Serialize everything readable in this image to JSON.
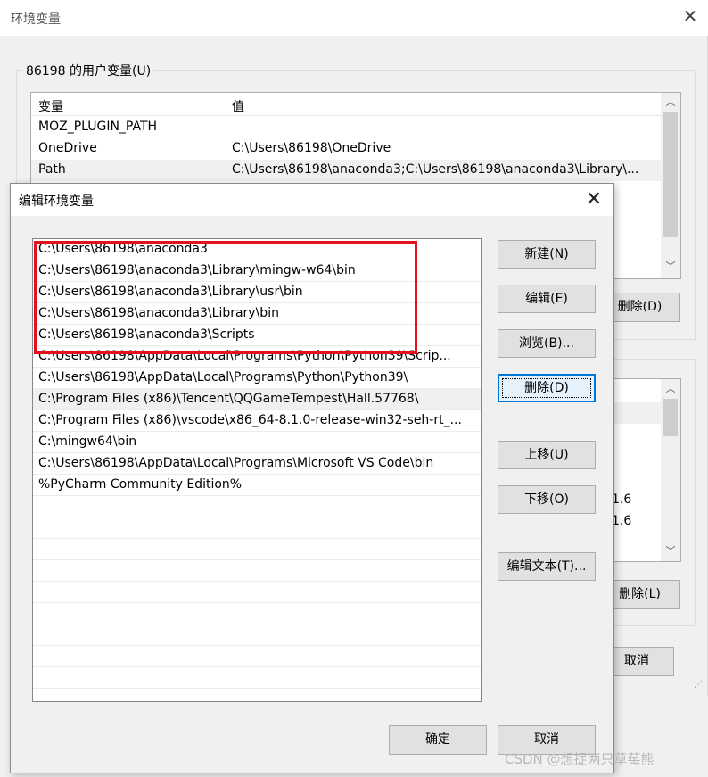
{
  "env_window": {
    "title": "环境变量",
    "close_glyph": "✕",
    "user_group_label": "86198 的用户变量(U)",
    "user_table": {
      "headers": [
        "变量",
        "值"
      ],
      "rows": [
        {
          "name": "MOZ_PLUGIN_PATH",
          "value": ""
        },
        {
          "name": "OneDrive",
          "value": "C:\\Users\\86198\\OneDrive"
        },
        {
          "name": "Path",
          "value": "C:\\Users\\86198\\anaconda3;C:\\Users\\86198\\anaconda3\\Library\\..."
        }
      ],
      "selected_index": 2
    },
    "user_delete_label": "删除(D)",
    "system_values": [
      "1.6",
      "1.6"
    ],
    "system_delete_label": "删除(L)",
    "cancel_label": "取消"
  },
  "edit_dialog": {
    "title": "编辑环境变量",
    "close_glyph": "✕",
    "paths": [
      "C:\\Users\\86198\\anaconda3",
      "C:\\Users\\86198\\anaconda3\\Library\\mingw-w64\\bin",
      "C:\\Users\\86198\\anaconda3\\Library\\usr\\bin",
      "C:\\Users\\86198\\anaconda3\\Library\\bin",
      "C:\\Users\\86198\\anaconda3\\Scripts",
      "C:\\Users\\86198\\AppData\\Local\\Programs\\Python\\Python39\\Scrip...",
      "C:\\Users\\86198\\AppData\\Local\\Programs\\Python\\Python39\\",
      "C:\\Program Files (x86)\\Tencent\\QQGameTempest\\Hall.57768\\",
      "C:\\Program Files (x86)\\vscode\\x86_64-8.1.0-release-win32-seh-rt_...",
      "C:\\mingw64\\bin",
      "C:\\Users\\86198\\AppData\\Local\\Programs\\Microsoft VS Code\\bin",
      "%PyCharm Community Edition%"
    ],
    "selected_index": 7,
    "highlighted_range": [
      0,
      4
    ],
    "highlight_color": "#e3101d",
    "buttons": {
      "new": "新建(N)",
      "edit": "编辑(E)",
      "browse": "浏览(B)...",
      "delete": "删除(D)",
      "move_up": "上移(U)",
      "move_down": "下移(O)",
      "edit_text": "编辑文本(T)...",
      "ok": "确定",
      "cancel": "取消"
    }
  },
  "watermark": "CSDN @想捉两只草莓熊"
}
